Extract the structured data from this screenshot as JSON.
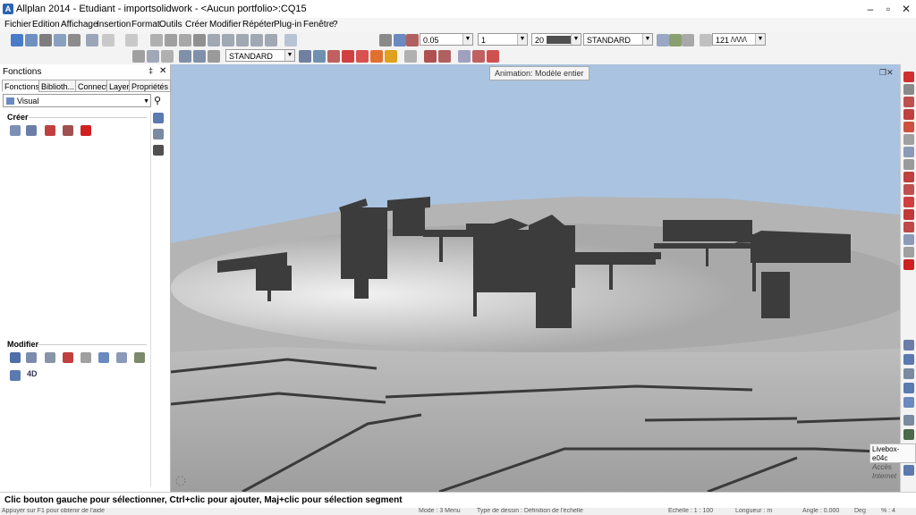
{
  "window": {
    "title": "Allplan 2014 - Etudiant - importsolidwork - <Aucun portfolio>:CQ15"
  },
  "menu": [
    "Fichier",
    "Edition",
    "Affichage",
    "Insertion",
    "Format",
    "Outils",
    "Créer",
    "Modifier",
    "Répéter",
    "Plug-in",
    "Fenêtre",
    "?"
  ],
  "toolbar": {
    "pen_thickness": "0.05",
    "line_type": "1",
    "color_number": "20",
    "format_combo": "STANDARD",
    "scale_value": "121",
    "layer_combo": "STANDARD"
  },
  "panel": {
    "title": "Fonctions",
    "tabs": [
      "Fonctions",
      "Biblioth...",
      "Connect",
      "Layer",
      "Propriétés"
    ],
    "dropdown": "Visual",
    "section_create": "Créer",
    "section_modify": "Modifier",
    "label_4d": "4D"
  },
  "tooltip": "Animation: Modèle entier",
  "network": {
    "name": "Livebox-e04c",
    "status": "Accès Internet"
  },
  "status": {
    "hint": "Clic bouton gauche pour sélectionner, Ctrl+clic pour ajouter, Maj+clic pour sélection segment"
  },
  "bottom": {
    "help": "Appuyer sur F1 pour obtenir de l'aide",
    "mode": "Mode : 3 Menu",
    "drawing_type": "Type de dessin : Définition de l'échelle",
    "scale": "Echelle : 1 : 100",
    "length": "Longueur : m",
    "angle": "Angle : 0.000",
    "deg": "Deg",
    "percent": "% : 4"
  },
  "colors": {
    "sky": "#a9c3e1",
    "terrain": "#b4b4b4",
    "accent_red": "#d02020"
  }
}
